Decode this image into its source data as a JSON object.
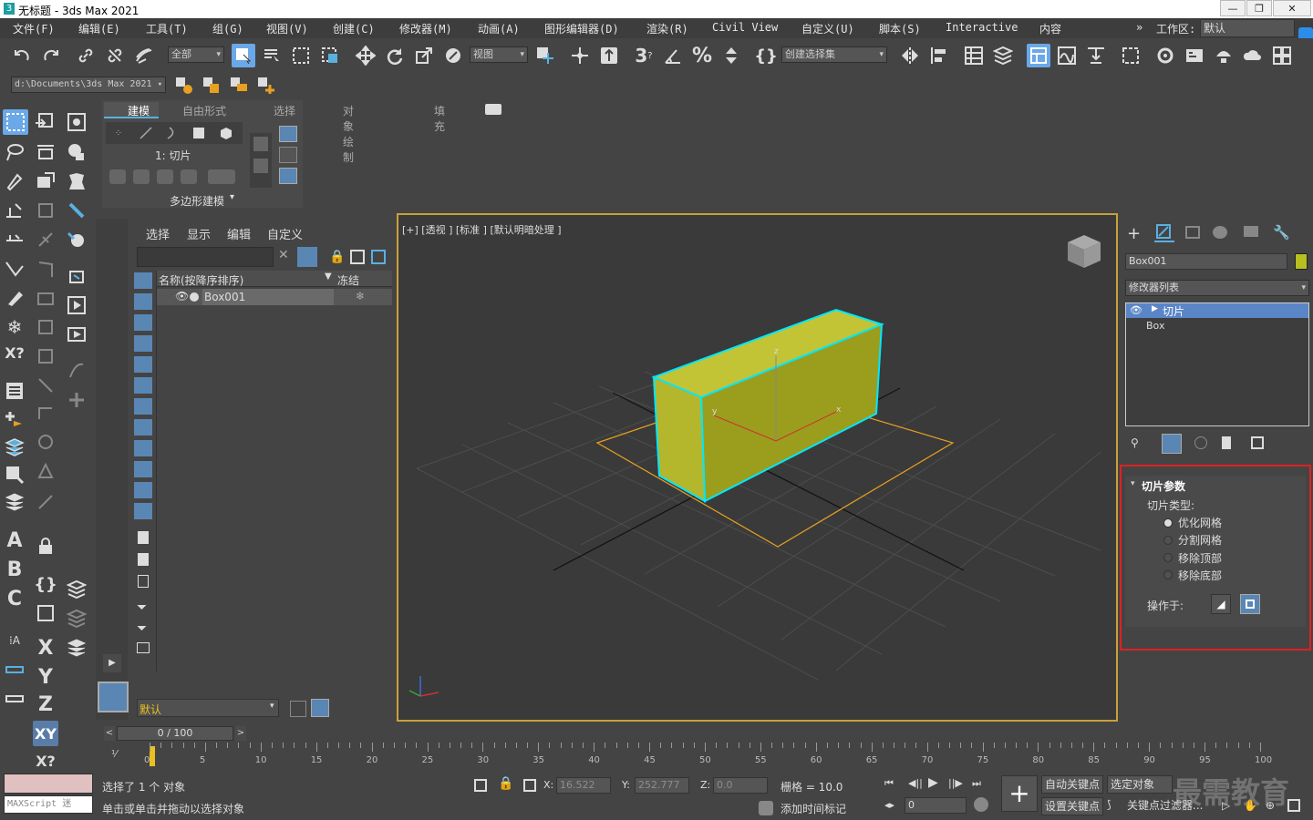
{
  "window": {
    "title": "无标题 - 3ds Max 2021"
  },
  "menu": [
    "文件(F)",
    "编辑(E)",
    "工具(T)",
    "组(G)",
    "视图(V)",
    "创建(C)",
    "修改器(M)",
    "动画(A)",
    "图形编辑器(D)",
    "渲染(R)",
    "Civil View",
    "自定义(U)",
    "脚本(S)",
    "Interactive",
    "内容"
  ],
  "workspace": {
    "label": "工作区:",
    "value": "默认"
  },
  "toolbar": {
    "filter": "全部",
    "refcoord": "视图",
    "selset": "创建选择集"
  },
  "project_path": "d:\\Documents\\3ds Max 2021",
  "ribbon": {
    "tabs": [
      "建模",
      "自由形式",
      "选择",
      "对象绘制",
      "填充"
    ],
    "current_label": "1: 切片",
    "footer": "多边形建模"
  },
  "scene": {
    "tabs": [
      "选择",
      "显示",
      "编辑",
      "自定义"
    ],
    "col_name": "名称(按降序排序)",
    "col_freeze": "冻结",
    "rows": [
      {
        "name": "Box001"
      }
    ],
    "layer": "默认"
  },
  "viewport": {
    "label": "[+] [透视 ] [标准 ] [默认明暗处理 ]"
  },
  "right": {
    "object_name": "Box001",
    "object_color": "#b8c020",
    "modifier_list": "修改器列表",
    "stack": [
      "切片",
      "Box"
    ],
    "rollout": {
      "title": "切片参数",
      "slice_type": "切片类型:",
      "options": [
        "优化网格",
        "分割网格",
        "移除顶部",
        "移除底部"
      ],
      "selected": 0,
      "operate_on": "操作于:"
    }
  },
  "timeline": {
    "frame": "0 / 100",
    "ticks": [
      "0",
      "5",
      "10",
      "15",
      "20",
      "25",
      "30",
      "35",
      "40",
      "45",
      "50",
      "55",
      "60",
      "65",
      "70",
      "75",
      "80",
      "85",
      "90",
      "95",
      "100"
    ]
  },
  "status": {
    "maxscript": "MAXScript 迷",
    "selected": "选择了 1 个 对象",
    "hint": "单击或单击并拖动以选择对象",
    "x_label": "X:",
    "x": "16.522",
    "y_label": "Y:",
    "y": "252.777",
    "z_label": "Z:",
    "z": "0.0",
    "grid": "栅格 = 10.0",
    "add_tag": "添加时间标记",
    "auto_key": "自动关键点",
    "sel_obj": "选定对象",
    "set_key": "设置关键点",
    "key_filter": "关键点过滤器...",
    "frame": "0",
    "watermark": "最需教育"
  }
}
